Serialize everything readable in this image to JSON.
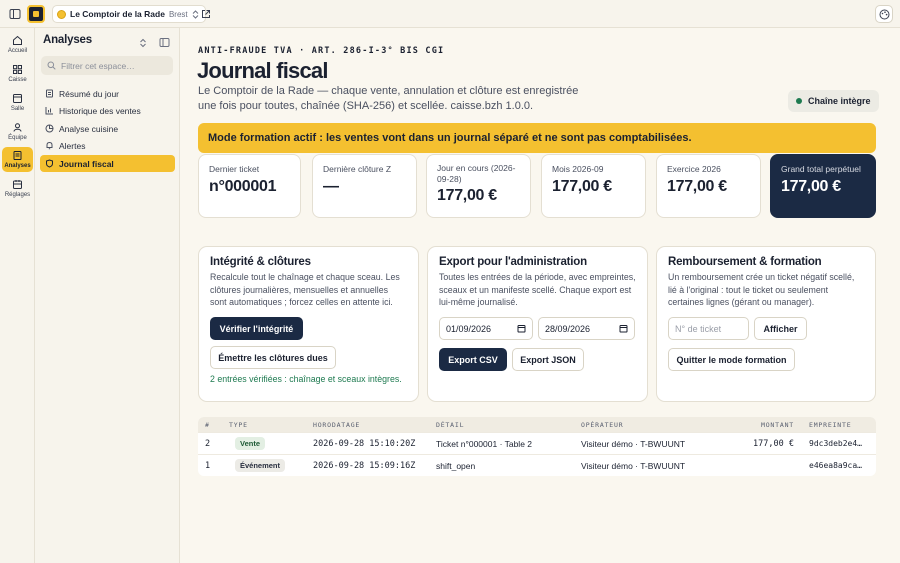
{
  "topbar": {
    "shop_name": "Le Comptoir de la Rade",
    "shop_city": "Brest"
  },
  "rail": [
    {
      "label": "Accueil",
      "icon": "home-icon"
    },
    {
      "label": "Caisse",
      "icon": "grid-icon"
    },
    {
      "label": "Salle",
      "icon": "table-icon"
    },
    {
      "label": "Équipe",
      "icon": "team-icon"
    },
    {
      "label": "Analyses",
      "icon": "book-icon",
      "active": true
    },
    {
      "label": "Réglages",
      "icon": "settings-icon"
    }
  ],
  "sidebar": {
    "title": "Analyses",
    "search_placeholder": "Filtrer cet espace…",
    "items": [
      {
        "label": "Résumé du jour",
        "icon": "document-icon"
      },
      {
        "label": "Historique des ventes",
        "icon": "chart-icon"
      },
      {
        "label": "Analyse cuisine",
        "icon": "pie-icon"
      },
      {
        "label": "Alertes",
        "icon": "bell-icon"
      },
      {
        "label": "Journal fiscal",
        "icon": "shield-icon",
        "active": true
      }
    ]
  },
  "header": {
    "eyebrow": "ANTI-FRAUDE TVA · ART. 286-I-3° BIS CGI",
    "title": "Journal fiscal",
    "subtitle": "Le Comptoir de la Rade — chaque vente, annulation et clôture est enregistrée une fois pour toutes, chaînée (SHA-256) et scellée. caisse.bzh 1.0.0.",
    "chain_status": "Chaîne intègre"
  },
  "banner": "Mode formation actif : les ventes vont dans un journal séparé et ne sont pas comptabilisées.",
  "stats": [
    {
      "label": "Dernier ticket",
      "value": "n°000001"
    },
    {
      "label": "Dernière clôture Z",
      "value": "—"
    },
    {
      "label": "Jour en cours (2026-09-28)",
      "value": "177,00 €"
    },
    {
      "label": "Mois 2026-09",
      "value": "177,00 €"
    },
    {
      "label": "Exercice 2026",
      "value": "177,00 €"
    },
    {
      "label": "Grand total perpétuel",
      "value": "177,00 €"
    }
  ],
  "integrity": {
    "title": "Intégrité & clôtures",
    "desc": "Recalcule tout le chaînage et chaque sceau. Les clôtures journalières, mensuelles et annuelles sont automatiques ; forcez celles en attente ici.",
    "verify_label": "Vérifier l'intégrité",
    "close_label": "Émettre les clôtures dues",
    "result": "2 entrées vérifiées : chaînage et sceaux intègres."
  },
  "export": {
    "title": "Export pour l'administration",
    "desc": "Toutes les entrées de la période, avec empreintes, sceaux et un manifeste scellé. Chaque export est lui-même journalisé.",
    "date_from": "01/09/2026",
    "date_to": "28/09/2026",
    "csv_label": "Export CSV",
    "json_label": "Export JSON"
  },
  "refund": {
    "title": "Remboursement & formation",
    "desc": "Un remboursement crée un ticket négatif scellé, lié à l'original : tout le ticket ou seulement certaines lignes (gérant ou manager).",
    "ticket_placeholder": "N° de ticket",
    "show_label": "Afficher",
    "quit_label": "Quitter le mode formation"
  },
  "table": {
    "headers": [
      "#",
      "TYPE",
      "HORODATAGE",
      "DÉTAIL",
      "OPÉRATEUR",
      "MONTANT",
      "EMPREINTE"
    ],
    "rows": [
      {
        "num": "2",
        "type": "Vente",
        "tag": "green",
        "time": "2026-09-28 15:10:20Z",
        "detail": "Ticket n°000001 · Table 2",
        "operator": "Visiteur démo · T-BWUUNT",
        "amount": "177,00 €",
        "hash": "9dc3deb2e4…"
      },
      {
        "num": "1",
        "type": "Événement",
        "tag": "gray",
        "time": "2026-09-28 15:09:16Z",
        "detail": "shift_open",
        "operator": "Visiteur démo · T-BWUUNT",
        "amount": "",
        "hash": "e46ea8a9ca…"
      }
    ]
  }
}
